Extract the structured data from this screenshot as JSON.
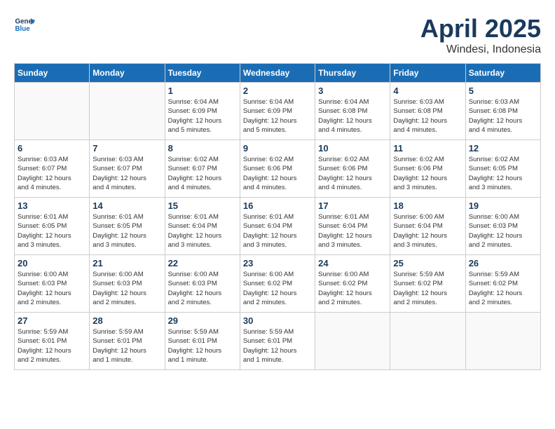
{
  "header": {
    "logo_line1": "General",
    "logo_line2": "Blue",
    "month": "April 2025",
    "location": "Windesi, Indonesia"
  },
  "weekdays": [
    "Sunday",
    "Monday",
    "Tuesday",
    "Wednesday",
    "Thursday",
    "Friday",
    "Saturday"
  ],
  "weeks": [
    [
      {
        "day": "",
        "info": ""
      },
      {
        "day": "",
        "info": ""
      },
      {
        "day": "1",
        "info": "Sunrise: 6:04 AM\nSunset: 6:09 PM\nDaylight: 12 hours\nand 5 minutes."
      },
      {
        "day": "2",
        "info": "Sunrise: 6:04 AM\nSunset: 6:09 PM\nDaylight: 12 hours\nand 5 minutes."
      },
      {
        "day": "3",
        "info": "Sunrise: 6:04 AM\nSunset: 6:08 PM\nDaylight: 12 hours\nand 4 minutes."
      },
      {
        "day": "4",
        "info": "Sunrise: 6:03 AM\nSunset: 6:08 PM\nDaylight: 12 hours\nand 4 minutes."
      },
      {
        "day": "5",
        "info": "Sunrise: 6:03 AM\nSunset: 6:08 PM\nDaylight: 12 hours\nand 4 minutes."
      }
    ],
    [
      {
        "day": "6",
        "info": "Sunrise: 6:03 AM\nSunset: 6:07 PM\nDaylight: 12 hours\nand 4 minutes."
      },
      {
        "day": "7",
        "info": "Sunrise: 6:03 AM\nSunset: 6:07 PM\nDaylight: 12 hours\nand 4 minutes."
      },
      {
        "day": "8",
        "info": "Sunrise: 6:02 AM\nSunset: 6:07 PM\nDaylight: 12 hours\nand 4 minutes."
      },
      {
        "day": "9",
        "info": "Sunrise: 6:02 AM\nSunset: 6:06 PM\nDaylight: 12 hours\nand 4 minutes."
      },
      {
        "day": "10",
        "info": "Sunrise: 6:02 AM\nSunset: 6:06 PM\nDaylight: 12 hours\nand 4 minutes."
      },
      {
        "day": "11",
        "info": "Sunrise: 6:02 AM\nSunset: 6:06 PM\nDaylight: 12 hours\nand 3 minutes."
      },
      {
        "day": "12",
        "info": "Sunrise: 6:02 AM\nSunset: 6:05 PM\nDaylight: 12 hours\nand 3 minutes."
      }
    ],
    [
      {
        "day": "13",
        "info": "Sunrise: 6:01 AM\nSunset: 6:05 PM\nDaylight: 12 hours\nand 3 minutes."
      },
      {
        "day": "14",
        "info": "Sunrise: 6:01 AM\nSunset: 6:05 PM\nDaylight: 12 hours\nand 3 minutes."
      },
      {
        "day": "15",
        "info": "Sunrise: 6:01 AM\nSunset: 6:04 PM\nDaylight: 12 hours\nand 3 minutes."
      },
      {
        "day": "16",
        "info": "Sunrise: 6:01 AM\nSunset: 6:04 PM\nDaylight: 12 hours\nand 3 minutes."
      },
      {
        "day": "17",
        "info": "Sunrise: 6:01 AM\nSunset: 6:04 PM\nDaylight: 12 hours\nand 3 minutes."
      },
      {
        "day": "18",
        "info": "Sunrise: 6:00 AM\nSunset: 6:04 PM\nDaylight: 12 hours\nand 3 minutes."
      },
      {
        "day": "19",
        "info": "Sunrise: 6:00 AM\nSunset: 6:03 PM\nDaylight: 12 hours\nand 2 minutes."
      }
    ],
    [
      {
        "day": "20",
        "info": "Sunrise: 6:00 AM\nSunset: 6:03 PM\nDaylight: 12 hours\nand 2 minutes."
      },
      {
        "day": "21",
        "info": "Sunrise: 6:00 AM\nSunset: 6:03 PM\nDaylight: 12 hours\nand 2 minutes."
      },
      {
        "day": "22",
        "info": "Sunrise: 6:00 AM\nSunset: 6:03 PM\nDaylight: 12 hours\nand 2 minutes."
      },
      {
        "day": "23",
        "info": "Sunrise: 6:00 AM\nSunset: 6:02 PM\nDaylight: 12 hours\nand 2 minutes."
      },
      {
        "day": "24",
        "info": "Sunrise: 6:00 AM\nSunset: 6:02 PM\nDaylight: 12 hours\nand 2 minutes."
      },
      {
        "day": "25",
        "info": "Sunrise: 5:59 AM\nSunset: 6:02 PM\nDaylight: 12 hours\nand 2 minutes."
      },
      {
        "day": "26",
        "info": "Sunrise: 5:59 AM\nSunset: 6:02 PM\nDaylight: 12 hours\nand 2 minutes."
      }
    ],
    [
      {
        "day": "27",
        "info": "Sunrise: 5:59 AM\nSunset: 6:01 PM\nDaylight: 12 hours\nand 2 minutes."
      },
      {
        "day": "28",
        "info": "Sunrise: 5:59 AM\nSunset: 6:01 PM\nDaylight: 12 hours\nand 1 minute."
      },
      {
        "day": "29",
        "info": "Sunrise: 5:59 AM\nSunset: 6:01 PM\nDaylight: 12 hours\nand 1 minute."
      },
      {
        "day": "30",
        "info": "Sunrise: 5:59 AM\nSunset: 6:01 PM\nDaylight: 12 hours\nand 1 minute."
      },
      {
        "day": "",
        "info": ""
      },
      {
        "day": "",
        "info": ""
      },
      {
        "day": "",
        "info": ""
      }
    ]
  ]
}
